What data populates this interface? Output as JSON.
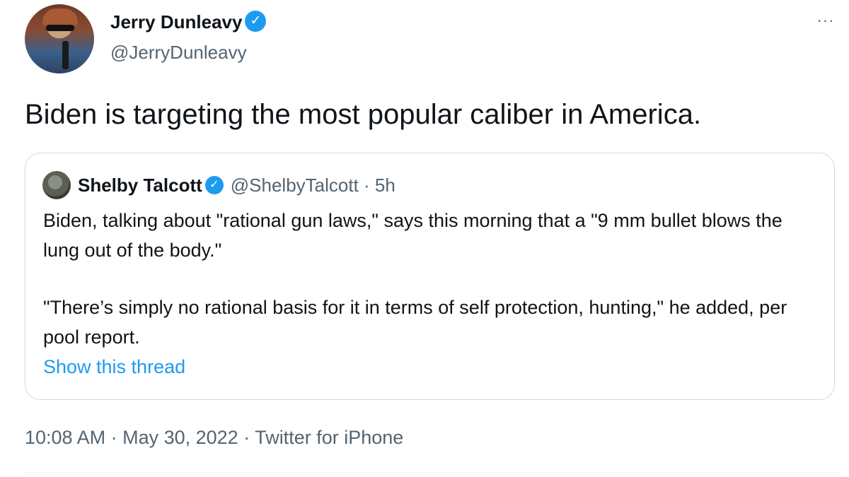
{
  "author": {
    "display_name": "Jerry Dunleavy",
    "handle": "@JerryDunleavy",
    "verified_icon": "verified-badge-icon",
    "more_label": "···"
  },
  "tweet": {
    "text": "Biden is targeting the most popular caliber in America."
  },
  "quoted": {
    "display_name": "Shelby Talcott",
    "handle_time": "@ShelbyTalcott · 5h",
    "paragraph1": "Biden, talking about \"rational gun laws,\" says this morning that a \"9 mm bullet blows the lung out of the body.\"",
    "paragraph2": "\"There’s simply no rational basis for it in terms of self protection, hunting,\" he added, per pool report.",
    "show_thread": "Show this thread"
  },
  "meta": {
    "timestamp_source": "10:08 AM · May 30, 2022 · Twitter for iPhone"
  },
  "colors": {
    "accent": "#1d9bf0",
    "text": "#0f1419",
    "secondary": "#536471",
    "border": "#cfd9de"
  }
}
